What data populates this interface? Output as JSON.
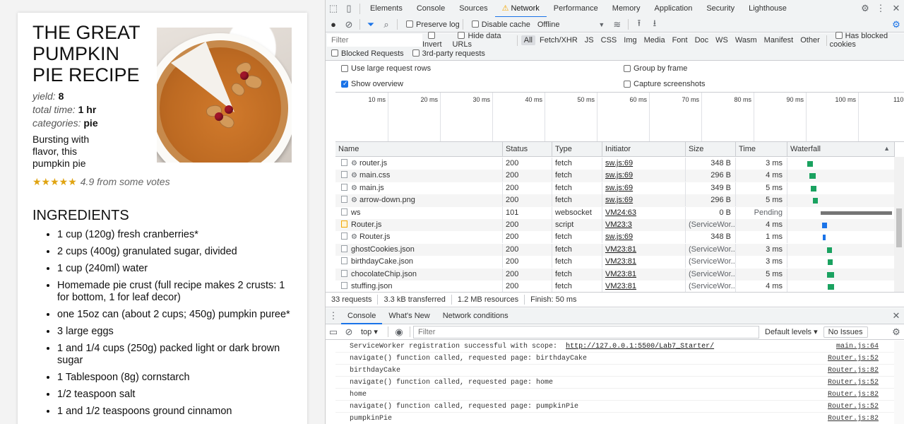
{
  "recipe": {
    "title": "THE GREAT PUMPKIN PIE RECIPE",
    "yield_label": "yield:",
    "yield_value": "8",
    "time_label": "total time:",
    "time_value": "1 hr",
    "categories_label": "categories:",
    "categories_value": "pie",
    "description": "Bursting with flavor, this pumpkin pie",
    "stars": "★★★★★",
    "rating_text": "4.9 from some votes",
    "ingredients_heading": "INGREDIENTS",
    "ingredients": [
      "1 cup (120g) fresh cranberries*",
      "2 cups (400g) granulated sugar, divided",
      "1 cup (240ml) water",
      "Homemade pie crust (full recipe makes 2 crusts: 1 for bottom, 1 for leaf decor)",
      "one 15oz can (about 2 cups; 450g) pumpkin puree*",
      "3 large eggs",
      "1 and 1/4 cups (250g) packed light or dark brown sugar",
      "1 Tablespoon (8g) cornstarch",
      "1/2 teaspoon salt",
      "1 and 1/2 teaspoons ground cinnamon"
    ]
  },
  "devtools": {
    "tabs": [
      "Elements",
      "Console",
      "Sources",
      "Network",
      "Performance",
      "Memory",
      "Application",
      "Security",
      "Lighthouse"
    ],
    "active_tab": "Network",
    "toolbar": {
      "preserve_log": "Preserve log",
      "disable_cache": "Disable cache",
      "throttle": "Offline"
    },
    "filter": {
      "placeholder": "Filter",
      "invert": "Invert",
      "hide_data_urls": "Hide data URLs",
      "types": [
        "All",
        "Fetch/XHR",
        "JS",
        "CSS",
        "Img",
        "Media",
        "Font",
        "Doc",
        "WS",
        "Wasm",
        "Manifest",
        "Other"
      ],
      "active_type": "All",
      "has_blocked_cookies": "Has blocked cookies",
      "blocked_requests": "Blocked Requests",
      "third_party": "3rd-party requests"
    },
    "options": {
      "large_rows": "Use large request rows",
      "group_by_frame": "Group by frame",
      "show_overview": "Show overview",
      "capture_screenshots": "Capture screenshots"
    },
    "overview_ticks": [
      "10 ms",
      "20 ms",
      "30 ms",
      "40 ms",
      "50 ms",
      "60 ms",
      "70 ms",
      "80 ms",
      "90 ms",
      "100 ms",
      "110"
    ],
    "columns": [
      "Name",
      "Status",
      "Type",
      "Initiator",
      "Size",
      "Time",
      "Waterfall"
    ],
    "rows": [
      {
        "name": "router.js",
        "sw": true,
        "status": "200",
        "type": "fetch",
        "initiator": "sw.js:69",
        "size": "348 B",
        "time": "3 ms",
        "wf_start": 0.17,
        "wf_len": 0.05,
        "wf_color": "#1aa260"
      },
      {
        "name": "main.css",
        "sw": true,
        "status": "200",
        "type": "fetch",
        "initiator": "sw.js:69",
        "size": "296 B",
        "time": "4 ms",
        "wf_start": 0.19,
        "wf_len": 0.06,
        "wf_color": "#1aa260"
      },
      {
        "name": "main.js",
        "sw": true,
        "status": "200",
        "type": "fetch",
        "initiator": "sw.js:69",
        "size": "349 B",
        "time": "5 ms",
        "wf_start": 0.2,
        "wf_len": 0.06,
        "wf_color": "#1aa260"
      },
      {
        "name": "arrow-down.png",
        "sw": true,
        "status": "200",
        "type": "fetch",
        "initiator": "sw.js:69",
        "size": "296 B",
        "time": "5 ms",
        "wf_start": 0.22,
        "wf_len": 0.05,
        "wf_color": "#1aa260"
      },
      {
        "name": "ws",
        "sw": false,
        "status": "101",
        "type": "websocket",
        "initiator": "VM24:63",
        "size": "0 B",
        "time": "Pending",
        "wf_start": 0.3,
        "wf_len": 0.7,
        "wf_color": "#757575"
      },
      {
        "name": "Router.js",
        "sw": false,
        "js": true,
        "status": "200",
        "type": "script",
        "initiator": "VM23:3",
        "size": "(ServiceWor...",
        "time": "4 ms",
        "wf_start": 0.31,
        "wf_len": 0.05,
        "wf_color": "#1a73e8"
      },
      {
        "name": "Router.js",
        "sw": true,
        "status": "200",
        "type": "fetch",
        "initiator": "sw.js:69",
        "size": "348 B",
        "time": "1 ms",
        "wf_start": 0.32,
        "wf_len": 0.03,
        "wf_color": "#1a73e8"
      },
      {
        "name": "ghostCookies.json",
        "sw": false,
        "status": "200",
        "type": "fetch",
        "initiator": "VM23:81",
        "size": "(ServiceWor...",
        "time": "3 ms",
        "wf_start": 0.36,
        "wf_len": 0.05,
        "wf_color": "#1aa260"
      },
      {
        "name": "birthdayCake.json",
        "sw": false,
        "status": "200",
        "type": "fetch",
        "initiator": "VM23:81",
        "size": "(ServiceWor...",
        "time": "3 ms",
        "wf_start": 0.37,
        "wf_len": 0.05,
        "wf_color": "#1aa260"
      },
      {
        "name": "chocolateChip.json",
        "sw": false,
        "status": "200",
        "type": "fetch",
        "initiator": "VM23:81",
        "size": "(ServiceWor...",
        "time": "5 ms",
        "wf_start": 0.36,
        "wf_len": 0.07,
        "wf_color": "#1aa260"
      },
      {
        "name": "stuffing.json",
        "sw": false,
        "status": "200",
        "type": "fetch",
        "initiator": "VM23:81",
        "size": "(ServiceWor...",
        "time": "4 ms",
        "wf_start": 0.37,
        "wf_len": 0.06,
        "wf_color": "#1aa260"
      }
    ],
    "summary": [
      "33 requests",
      "3.3 kB transferred",
      "1.2 MB resources",
      "Finish: 50 ms"
    ],
    "drawer_tabs": [
      "Console",
      "What's New",
      "Network conditions"
    ],
    "drawer_active": "Console",
    "console": {
      "context": "top",
      "filter_placeholder": "Filter",
      "levels": "Default levels",
      "issues": "No Issues",
      "logs": [
        {
          "msg": "ServiceWorker registration successful with scope:  ",
          "url": "http://127.0.0.1:5500/Lab7_Starter/",
          "src": "main.js:64"
        },
        {
          "msg": "navigate() function called, requested page: birthdayCake",
          "url": "",
          "src": "Router.js:52"
        },
        {
          "msg": "birthdayCake",
          "url": "",
          "src": "Router.js:82"
        },
        {
          "msg": "navigate() function called, requested page: home",
          "url": "",
          "src": "Router.js:52"
        },
        {
          "msg": "home",
          "url": "",
          "src": "Router.js:82"
        },
        {
          "msg": "navigate() function called, requested page: pumpkinPie",
          "url": "",
          "src": "Router.js:52"
        },
        {
          "msg": "pumpkinPie",
          "url": "",
          "src": "Router.js:82"
        }
      ]
    }
  }
}
